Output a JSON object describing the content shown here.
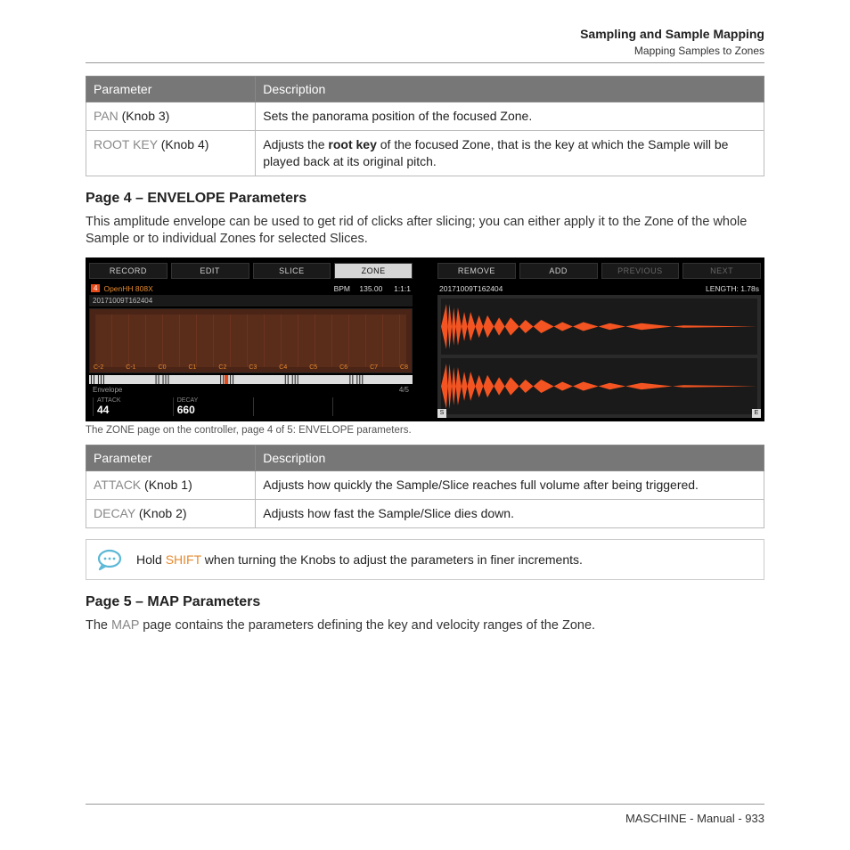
{
  "header": {
    "title": "Sampling and Sample Mapping",
    "subtitle": "Mapping Samples to Zones"
  },
  "table1": {
    "headers": [
      "Parameter",
      "Description"
    ],
    "rows": [
      {
        "param_grey": "PAN",
        "param_rest": " (Knob 3)",
        "desc": "Sets the panorama position of the focused Zone."
      },
      {
        "param_grey": "ROOT KEY",
        "param_rest": " (Knob 4)",
        "desc_pre": "Adjusts the ",
        "desc_bold": "root key",
        "desc_post": " of the focused Zone, that is the key at which the Sample will be played back at its original pitch."
      }
    ]
  },
  "section1_heading": "Page 4 – ENVELOPE Parameters",
  "section1_body": "This amplitude envelope can be used to get rid of clicks after slicing; you can either apply it to the Zone of the whole Sample or to individual Zones for selected Slices.",
  "controller": {
    "left_buttons": [
      "RECORD",
      "EDIT",
      "SLICE",
      "ZONE"
    ],
    "left_selected_index": 3,
    "pad_num": "4",
    "sample_title": "OpenHH 808X",
    "bpm_label": "BPM",
    "bpm_value": "135.00",
    "bars": "1:1:1",
    "sample_name_row": "20171009T162404",
    "octaves": [
      "C-2",
      "C-1",
      "C0",
      "C1",
      "C2",
      "C3",
      "C4",
      "C5",
      "C6",
      "C7",
      "C8"
    ],
    "env_label": "Envelope",
    "page_indicator": "4/5",
    "knob1_label": "ATTACK",
    "knob1_value": "44",
    "knob2_label": "DECAY",
    "knob2_value": "660",
    "right_buttons": [
      "REMOVE",
      "ADD",
      "PREVIOUS",
      "NEXT"
    ],
    "right_dim": [
      2,
      3
    ],
    "right_sample": "20171009T162404",
    "length_label": "LENGTH: 1.78s",
    "marker_s": "S",
    "marker_e": "E"
  },
  "caption1": "The ZONE page on the controller, page 4 of 5: ENVELOPE parameters.",
  "table2": {
    "headers": [
      "Parameter",
      "Description"
    ],
    "rows": [
      {
        "param_grey": "ATTACK",
        "param_rest": " (Knob 1)",
        "desc": "Adjusts how quickly the Sample/Slice reaches full volume after being triggered."
      },
      {
        "param_grey": "DECAY",
        "param_rest": " (Knob 2)",
        "desc": "Adjusts how fast the Sample/Slice dies down."
      }
    ]
  },
  "tip": {
    "pre": "Hold ",
    "shift": "SHIFT",
    "post": " when turning the Knobs to adjust the parameters in finer increments."
  },
  "section2_heading": "Page 5 – MAP Parameters",
  "section2_body_pre": "The ",
  "section2_body_grey": "MAP",
  "section2_body_post": " page contains the parameters defining the key and velocity ranges of the Zone.",
  "footer": "MASCHINE - Manual - 933"
}
